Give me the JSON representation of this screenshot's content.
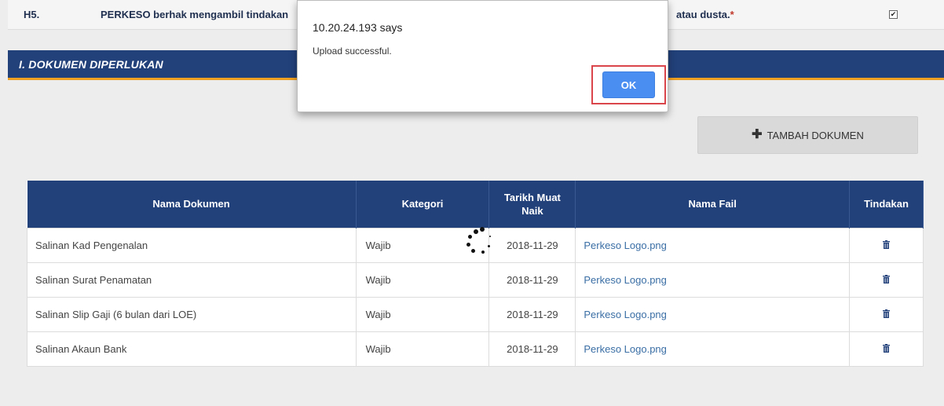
{
  "declaration": {
    "number": "H5.",
    "text_start": "PERKESO berhak mengambil tindakan",
    "text_end": "atau dusta.",
    "required_mark": "*",
    "checked": true
  },
  "section": {
    "title": "I. DOKUMEN DIPERLUKAN"
  },
  "add_button": {
    "label": "TAMBAH DOKUMEN",
    "icon": "plus-icon"
  },
  "table": {
    "headers": {
      "name": "Nama Dokumen",
      "category": "Kategori",
      "upload_date_line1": "Tarikh Muat",
      "upload_date_line2": "Naik",
      "file_name": "Nama Fail",
      "action": "Tindakan"
    },
    "rows": [
      {
        "name": "Salinan Kad Pengenalan",
        "category": "Wajib",
        "date": "2018-11-29",
        "file": "Perkeso Logo.png"
      },
      {
        "name": "Salinan Surat Penamatan",
        "category": "Wajib",
        "date": "2018-11-29",
        "file": "Perkeso Logo.png"
      },
      {
        "name": "Salinan Slip Gaji (6 bulan dari LOE)",
        "category": "Wajib",
        "date": "2018-11-29",
        "file": "Perkeso Logo.png"
      },
      {
        "name": "Salinan Akaun Bank",
        "category": "Wajib",
        "date": "2018-11-29",
        "file": "Perkeso Logo.png"
      }
    ]
  },
  "dialog": {
    "title": "10.20.24.193 says",
    "message": "Upload successful.",
    "ok_label": "OK"
  },
  "colors": {
    "header_blue": "#22407a",
    "accent_orange": "#f0a020",
    "link_blue": "#3a6ea5",
    "ok_blue": "#4a8ef2",
    "highlight_red": "#d9454a"
  }
}
